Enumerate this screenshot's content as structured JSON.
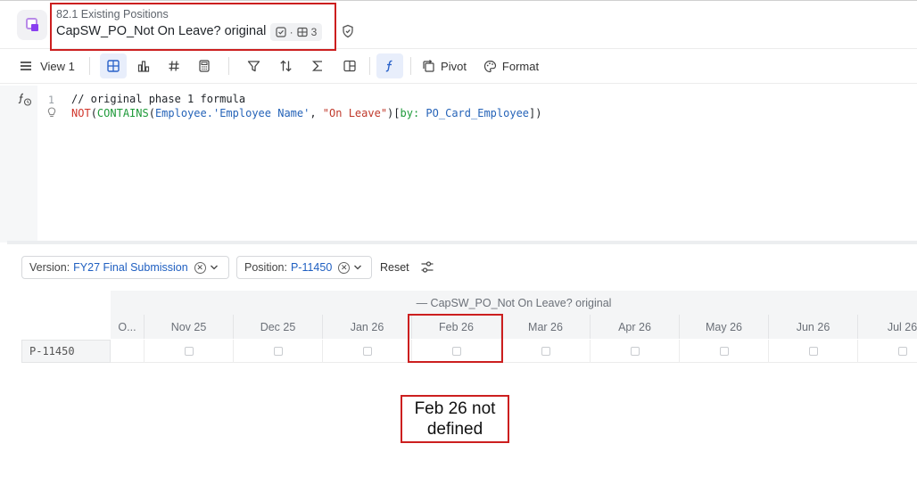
{
  "header": {
    "subtitle": "82.1 Existing Positions",
    "title": "CapSW_PO_Not On Leave? original",
    "badge_sep": "·",
    "badge_count": "3"
  },
  "toolbar": {
    "view_label": "View 1",
    "pivot_label": "Pivot",
    "format_label": "Format"
  },
  "formula": {
    "line1_num": "1",
    "line1": "// original phase 1 formula",
    "line2": {
      "fn_not": "NOT",
      "p1": "(",
      "fn_contains": "CONTAINS",
      "p2": "(",
      "ref": "Employee.'Employee Name'",
      "comma": ", ",
      "str": "\"On Leave\"",
      "p3": ")[",
      "kw": "by:",
      "space": " ",
      "by_ref": "PO_Card_Employee",
      "p4": "])"
    }
  },
  "filters": {
    "version_label": "Version:",
    "version_value": "FY27 Final Submission",
    "position_label": "Position:",
    "position_value": "P-11450",
    "reset_label": "Reset"
  },
  "grid": {
    "group_header": "— CapSW_PO_Not On Leave? original",
    "columns": [
      "O...",
      "Nov 25",
      "Dec 25",
      "Jan 26",
      "Feb 26",
      "Mar 26",
      "Apr 26",
      "May 26",
      "Jun 26",
      "Jul 26"
    ],
    "row_label": "P-11450"
  },
  "annotation": {
    "line1": "Feb 26 not",
    "line2": "defined"
  },
  "colors": {
    "accent": "#1f5fc1",
    "annotation_red": "#cc1f1f",
    "brand_purple": "#8a3ff0"
  }
}
